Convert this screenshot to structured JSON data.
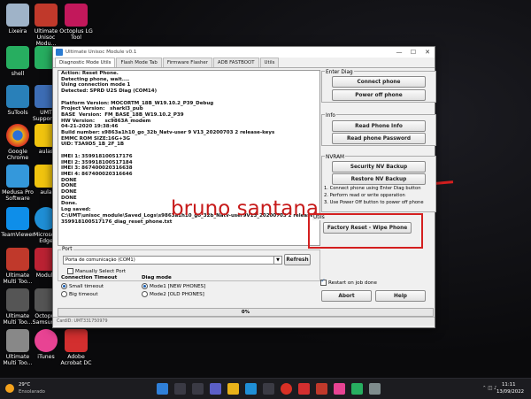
{
  "desktop": {
    "icons": [
      {
        "label": "Lixeira",
        "color": "#9fb3c8"
      },
      {
        "label": "Ultimate Unisoc Modu...",
        "color": "#c0392b"
      },
      {
        "label": "Octoplus LG Tool",
        "color": "#c2185b"
      },
      {
        "label": "shell",
        "color": "#27ae60"
      },
      {
        "label": "",
        "color": "#27ae60"
      },
      {
        "label": "SuTools",
        "color": "#2980b9"
      },
      {
        "label": "UMT Support...",
        "color": "#3d6db5"
      },
      {
        "label": "Google Chrome",
        "color": "#e8b21a"
      },
      {
        "label": "aulas",
        "color": "#f1c40f"
      },
      {
        "label": "Medusa Pro Software",
        "color": "#3498db"
      },
      {
        "label": "aula",
        "color": "#f1c40f"
      },
      {
        "label": "TeamViewer",
        "color": "#0e8ee9"
      },
      {
        "label": "Microsoft Edge",
        "color": "#1f8fd6"
      },
      {
        "label": "Ultimate Multi Too...",
        "color": "#c0392b"
      },
      {
        "label": "Module",
        "color": "#b23"
      },
      {
        "label": "Ultimate Multi Too...",
        "color": "#555"
      },
      {
        "label": "Octopus Samsun...",
        "color": "#555"
      },
      {
        "label": "Ultimate Multi Too...",
        "color": "#888"
      },
      {
        "label": "iTunes",
        "color": "#e84393"
      },
      {
        "label": "Adobe Acrobat DC",
        "color": "#d32f2f"
      }
    ]
  },
  "window": {
    "title": "Ultimate Unisoc Module v0.1",
    "controls": {
      "minimize": "—",
      "maximize": "☐",
      "close": "✕"
    },
    "tabs": [
      "Diagnostic Mode Utils",
      "Flash Mode Tab",
      "Firmware Flasher",
      "ADB FASTBOOT",
      "Utils"
    ],
    "log_lines": [
      "Action: Reset Phone.",
      "Detecting phone, wait....",
      "Using connection mode 1",
      "Detected: SPRD U2S Diag (COM14)",
      "",
      "Platform Version: MOCORTM_18B_W19.10.2_P39_Debug",
      "Project Version:   sharkl3_pub",
      "BASE  Version:  FM_BASE_18B_W19.10.2_P39",
      "HW Version:      sc9863A_modem",
      "04-21-2020 19:38:46",
      "Build number: s9863a1h10_go_32b_Natv-user 9 V13_20200703 2 release-keys",
      "EMMC ROM SIZE:16G+3G",
      "UID: T3A9D5_1B_2F_1B",
      "",
      "IMEI 1: 359918100517176",
      "IMEI 2: 359918100517184",
      "IMEI 3: 867400020316638",
      "IMEI 4: 867400020316646",
      "DONE",
      "DONE",
      "DONE",
      "DONE",
      "Done.",
      "Log saved:",
      "C:\\UMT\\unisoc_module\\Saved_Logs\\s9863a1h10_go_32b_Natv-user9V13_20200703 2 release-keys_",
      "359918100517176_diag_reset_phone.txt"
    ],
    "watermark": "bruno santana",
    "enter_diag": {
      "title": "Enter Diag",
      "connect": "Connect phone",
      "poweroff": "Power off phone"
    },
    "info": {
      "title": "Info",
      "read_info": "Read Phone Info",
      "read_password": "Read phone Password"
    },
    "nvram": {
      "title": "NVRAM",
      "security_backup": "Security NV Backup",
      "restore_backup": "Restore NV Backup",
      "instructions": [
        "1. Connect phone using Enter Diag button",
        "2. Perform read or write opperation",
        "3. Use Power Off button to power off phone"
      ]
    },
    "utils": {
      "title": "Utils",
      "factory_reset": "Factory Reset - Wipe Phone"
    },
    "port": {
      "title": "Port",
      "selected": "Porta de comunicação (COM1)",
      "refresh": "Refresh",
      "manual": "Manually Select Port"
    },
    "timeout": {
      "title": "Connection Timeout",
      "small": "Small timeout",
      "big": "Big timeout"
    },
    "diag_mode": {
      "title": "Diag mode",
      "mode1": "Mode1  [NEW PHONES]",
      "mode2": "Mode2 [OLD PHONES]"
    },
    "restart": "Restart on job done",
    "abort": "Abort",
    "help": "Help",
    "progress": {
      "label": "0%",
      "value": 0
    },
    "status": "CardID: UMT331750979"
  },
  "taskbar": {
    "weather_temp": "29°C",
    "weather_text": "Ensolarado",
    "time": "11:11",
    "date": "13/09/2022"
  },
  "colors": {
    "accent": "#d41f1f",
    "select_blue": "#1a5fb4"
  }
}
